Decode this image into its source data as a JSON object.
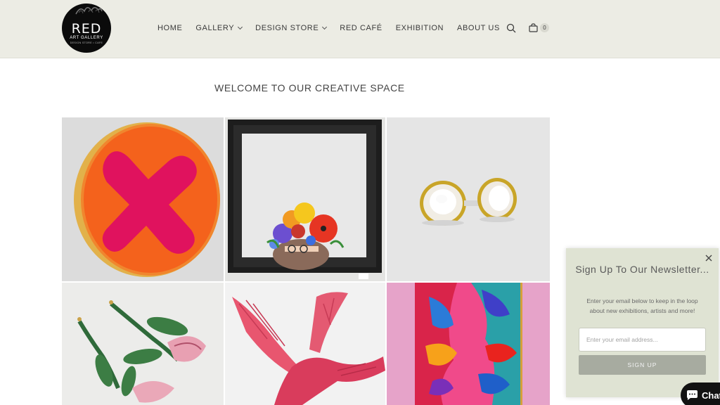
{
  "header": {
    "logo": {
      "title": "RED",
      "subtitle": "ART GALLERY",
      "tagline": "DESIGN STORE • CAFE"
    },
    "nav": [
      {
        "label": "HOME",
        "has_dropdown": false
      },
      {
        "label": "GALLERY",
        "has_dropdown": true
      },
      {
        "label": "DESIGN STORE",
        "has_dropdown": true
      },
      {
        "label": "RED CAFÉ",
        "has_dropdown": false
      },
      {
        "label": "EXHIBITION",
        "has_dropdown": false
      },
      {
        "label": "ABOUT US",
        "has_dropdown": false
      }
    ],
    "search_icon": "search-icon",
    "cart": {
      "icon": "shopping-bag-icon",
      "count": "0"
    }
  },
  "main": {
    "title": "WELCOME TO OUR CREATIVE SPACE",
    "gallery": [
      {
        "subject": "orange-disc-pink-x-artwork"
      },
      {
        "subject": "framed-flower-crown-portrait"
      },
      {
        "subject": "gold-pearl-earrings"
      },
      {
        "subject": "crochet-flower-earrings"
      },
      {
        "subject": "pink-glass-bird-sculpture"
      },
      {
        "subject": "colorful-faces-painting"
      }
    ]
  },
  "newsletter": {
    "title": "Sign Up To Our Newsletter...",
    "description": "Enter your email below to keep in the loop about new exhibitions, artists and more!",
    "email_placeholder": "Enter your email address...",
    "button_label": "SIGN UP",
    "close_icon": "close-icon"
  },
  "chat": {
    "label": "Chat",
    "icon": "chat-bubble-icon"
  },
  "colors": {
    "header_bg": "#ecece4",
    "popup_bg": "#dfe3d3",
    "button_bg": "#a7aba0",
    "text": "#3a3a3a"
  }
}
